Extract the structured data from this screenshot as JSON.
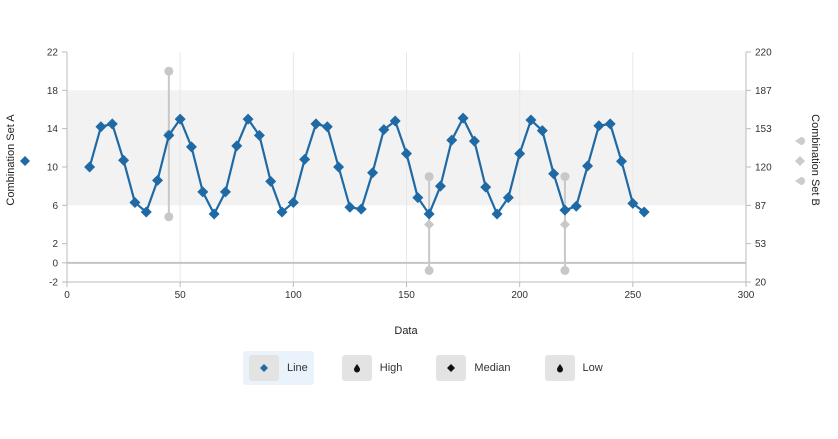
{
  "chart_data": {
    "type": "line",
    "x": [
      10,
      15,
      20,
      25,
      30,
      35,
      40,
      45,
      50,
      55,
      60,
      65,
      70,
      75,
      80,
      85,
      90,
      95,
      100,
      105,
      110,
      115,
      120,
      125,
      130,
      135,
      140,
      145,
      150,
      155,
      160,
      165,
      170,
      175,
      180,
      185,
      190,
      195,
      200,
      205,
      210,
      215,
      220,
      225,
      230,
      235,
      240,
      245,
      250,
      255
    ],
    "series": [
      {
        "name": "Line",
        "values": [
          10.0,
          14.2,
          14.5,
          10.7,
          6.3,
          5.3,
          8.6,
          13.3,
          15.0,
          12.1,
          7.4,
          5.1,
          7.4,
          12.2,
          15.0,
          13.3,
          8.5,
          5.3,
          6.3,
          10.8,
          14.5,
          14.2,
          10.0,
          5.8,
          5.6,
          9.4,
          13.9,
          14.8,
          11.4,
          6.8,
          5.1,
          8.0,
          12.8,
          15.1,
          12.7,
          7.9,
          5.1,
          6.8,
          11.4,
          14.9,
          13.8,
          9.3,
          5.5,
          5.9,
          10.1,
          14.3,
          14.5,
          10.6,
          6.2,
          5.3
        ]
      }
    ],
    "ranges": [
      {
        "x": 45,
        "high": 20,
        "median": 13.5,
        "low": 4.8
      },
      {
        "x": 160,
        "high": 9,
        "median": 4,
        "low": -0.8
      },
      {
        "x": 220,
        "high": 9,
        "median": 4,
        "low": -0.8
      }
    ],
    "band": {
      "from": 6,
      "to": 18
    },
    "xlabel": "Data",
    "ylabel_left": "Combination Set A",
    "ylabel_right": "Combination Set B",
    "xlim": [
      0,
      300
    ],
    "ylim": [
      -2,
      22
    ],
    "xticks": [
      "0",
      "50",
      "100",
      "150",
      "200",
      "250",
      "300"
    ],
    "yticks_left": [
      {
        "v": 22,
        "label": "22"
      },
      {
        "v": 18,
        "label": "18"
      },
      {
        "v": 14,
        "label": "14"
      },
      {
        "v": 10,
        "label": "10"
      },
      {
        "v": 6,
        "label": "6"
      },
      {
        "v": 2,
        "label": "2"
      },
      {
        "v": 0,
        "label": "0"
      },
      {
        "v": -2,
        "label": "-2"
      }
    ],
    "yticks_right": [
      {
        "v": 22,
        "label": "220"
      },
      {
        "v": 18,
        "label": "187"
      },
      {
        "v": 14,
        "label": "153"
      },
      {
        "v": 10,
        "label": "120"
      },
      {
        "v": 6,
        "label": "87"
      },
      {
        "v": 2,
        "label": "53"
      },
      {
        "v": -2,
        "label": "20"
      }
    ],
    "grid": true,
    "legend_position": "bottom",
    "colors": {
      "line": "#1f6aa5",
      "range": "#c8c8c8",
      "band": "#f2f2f2",
      "grid": "#e8e8e8",
      "axis": "#bbbbbb",
      "zero_line": "#c4c4c4"
    }
  },
  "legend": {
    "items": [
      {
        "label": "Line",
        "icon": "diamond-icon"
      },
      {
        "label": "High",
        "icon": "droplet-icon"
      },
      {
        "label": "Median",
        "icon": "diamond-icon"
      },
      {
        "label": "Low",
        "icon": "droplet-icon"
      }
    ]
  }
}
